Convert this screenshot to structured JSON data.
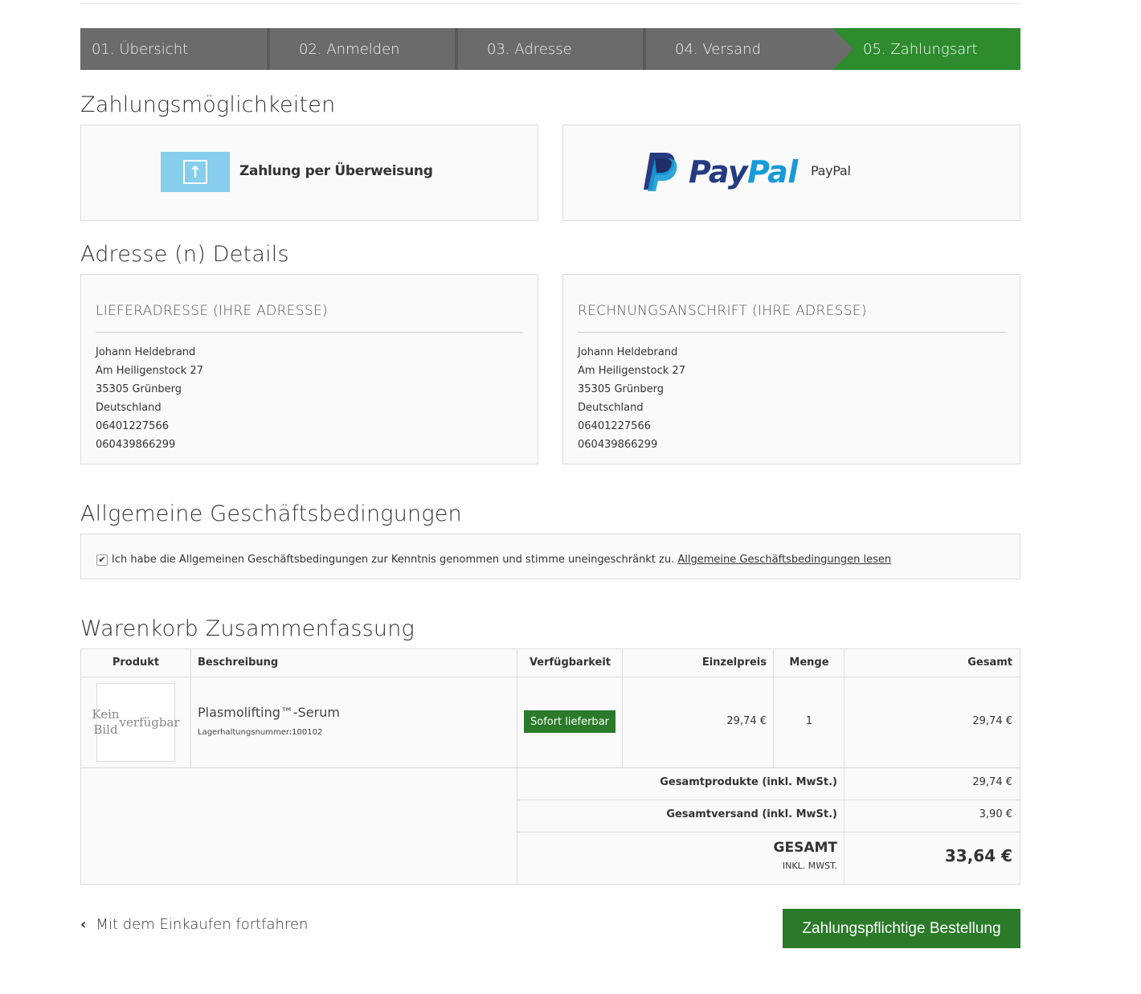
{
  "steps": [
    {
      "label": "01. Übersicht"
    },
    {
      "label": "02. Anmelden"
    },
    {
      "label": "03. Adresse"
    },
    {
      "label": "04. Versand"
    },
    {
      "label": "05. Zahlungsart"
    }
  ],
  "payment": {
    "heading": "Zahlungsmöglichkeiten",
    "transfer_label": "Zahlung per Überweisung",
    "paypal_logo_pay": "Pay",
    "paypal_logo_pal": "Pal",
    "paypal_label": "PayPal"
  },
  "address": {
    "heading": "Adresse (n) Details",
    "shipping": {
      "title": "LIEFERADRESSE (IHRE ADRESSE)",
      "lines": [
        "Johann Heldebrand",
        "Am Heiligenstock 27",
        "35305 Grünberg",
        "Deutschland",
        "06401227566",
        "060439866299"
      ]
    },
    "billing": {
      "title": "RECHNUNGSANSCHRIFT (IHRE ADRESSE)",
      "lines": [
        "Johann Heldebrand",
        "Am Heiligenstock 27",
        "35305 Grünberg",
        "Deutschland",
        "06401227566",
        "060439866299"
      ]
    }
  },
  "agb": {
    "heading": "Allgemeine Geschäftsbedingungen",
    "checked": true,
    "check_mark": "✔",
    "text": "Ich habe die Allgemeinen Geschäftsbedingungen zur Kenntnis genommen und stimme uneingeschränkt zu.",
    "link": "Allgemeine Geschäftsbedingungen lesen"
  },
  "cart": {
    "heading": "Warenkorb Zusammenfassung",
    "columns": {
      "product": "Produkt",
      "description": "Beschreibung",
      "availability": "Verfügbarkeit",
      "unit_price": "Einzelpreis",
      "quantity": "Menge",
      "total": "Gesamt"
    },
    "item": {
      "no_image": "Kein Bild verfügbar",
      "name": "Plasmolifting™-Serum",
      "sku": "Lagerhaltungsnummer:100102",
      "availability": "Sofort lieferbar",
      "unit_price": "29,74 €",
      "quantity": "1",
      "total": "29,74 €"
    },
    "summary": {
      "products_label": "Gesamtprodukte (inkl. MwSt.)",
      "products_value": "29,74 €",
      "shipping_label": "Gesamtversand (inkl. MwSt.)",
      "shipping_value": "3,90 €",
      "total_label": "GESAMT",
      "total_sublabel": "INKL. MWST.",
      "total_value": "33,64 €"
    }
  },
  "footer": {
    "continue_label": "Mit dem Einkaufen fortfahren",
    "order_button": "Zahlungspflichtige Bestellung"
  },
  "colors": {
    "accent_green": "#2e8b2e",
    "step_gray": "#6b6b6b",
    "paypal_dark": "#253b80",
    "paypal_light": "#179bd7"
  }
}
